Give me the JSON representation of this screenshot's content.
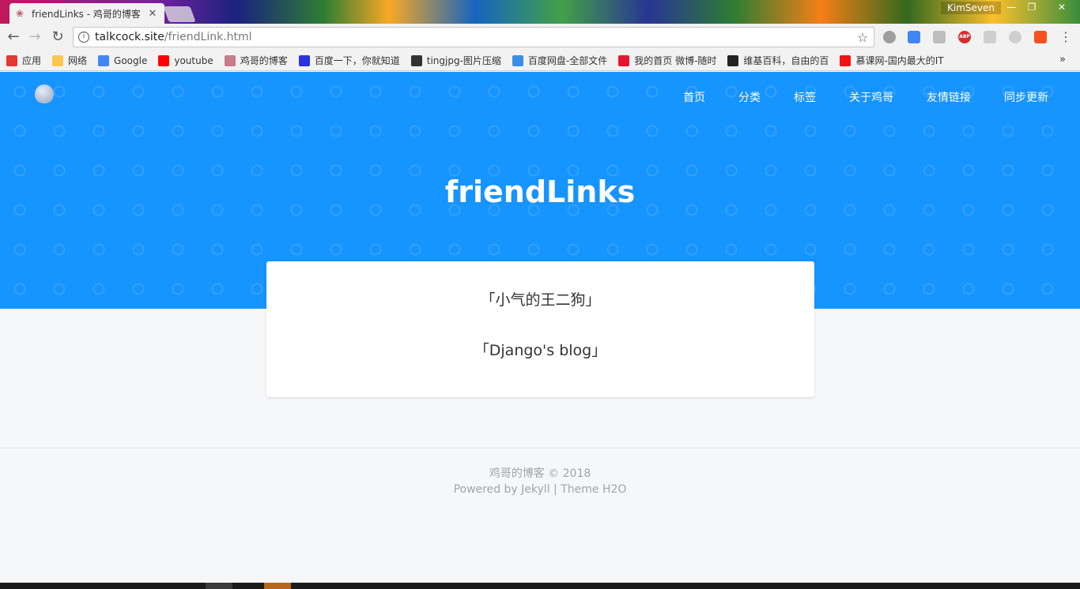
{
  "browser": {
    "tab_title": "friendLinks - 鸡哥的博客",
    "user": "KimSeven",
    "url_host": "talkcock.site",
    "url_path": "/friendLink.html",
    "icons": {
      "back": "←",
      "forward": "→",
      "reload": "↻",
      "star": "☆",
      "menu": "⋮",
      "close_tab": "✕",
      "info": "i",
      "minimize": "—",
      "maximize": "❐",
      "close_window": "✕",
      "overflow": "»"
    },
    "bookmarks": [
      {
        "label": "应用",
        "icon": "apps-icon",
        "color": "#e53935"
      },
      {
        "label": "网络",
        "icon": "folder-icon",
        "color": "#f9c74f"
      },
      {
        "label": "Google",
        "icon": "google-icon",
        "color": "#4285f4"
      },
      {
        "label": "youtube",
        "icon": "youtube-icon",
        "color": "#ff0000"
      },
      {
        "label": "鸡哥的博客",
        "icon": "blog-icon",
        "color": "#c77d8e"
      },
      {
        "label": "百度一下，你就知道",
        "icon": "baidu-icon",
        "color": "#2932e1"
      },
      {
        "label": "tingjpg-图片压缩",
        "icon": "panda-icon",
        "color": "#333333"
      },
      {
        "label": "百度网盘-全部文件",
        "icon": "baidu-pan-icon",
        "color": "#3a8ee6"
      },
      {
        "label": "我的首页 微博-随时",
        "icon": "weibo-icon",
        "color": "#e6162d"
      },
      {
        "label": "维基百科，自由的百",
        "icon": "wikipedia-icon",
        "color": "#222222"
      },
      {
        "label": "慕课网-国内最大的IT",
        "icon": "imooc-icon",
        "color": "#f01414"
      }
    ]
  },
  "site": {
    "nav": [
      "首页",
      "分类",
      "标签",
      "关于鸡哥",
      "友情链接",
      "同步更新"
    ],
    "title": "friendLinks",
    "links": [
      "「小气的王二狗」",
      "「Django's blog」"
    ],
    "footer_line1": "鸡哥的博客 © 2018",
    "footer_line2": "Powered by Jekyll | Theme H2O"
  },
  "colors": {
    "hero": "#1694ff",
    "background": "#f6f7f9"
  }
}
